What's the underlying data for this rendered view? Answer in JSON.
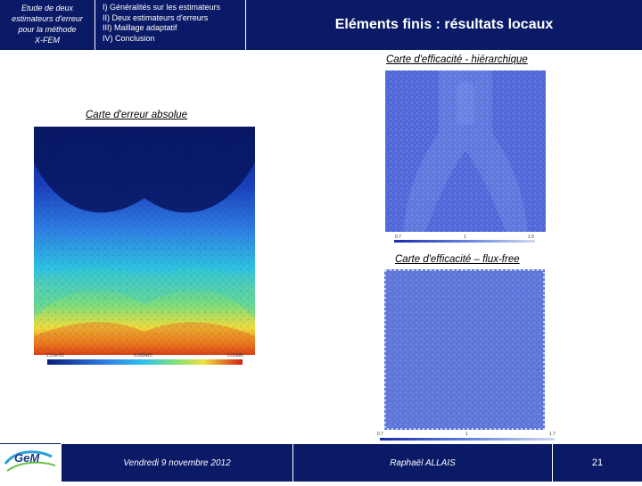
{
  "header": {
    "thesis_title_lines": [
      "Etude de deux",
      "estimateurs d'erreur",
      "pour la méthode",
      "X-FEM"
    ],
    "outline_items": [
      "I) Généralités sur les estimateurs",
      "II) Deux estimateurs d'erreurs",
      "III) Maillage adaptatif",
      "IV) Conclusion"
    ],
    "slide_title": "Eléments finis : résultats locaux"
  },
  "figures": {
    "absolute_error": {
      "caption": "Carte d'erreur  absolue",
      "legend_ticks": [
        "2.21e-05",
        "0.003425",
        "0.00685"
      ]
    },
    "hierarchical": {
      "caption": "Carte d'efficacité - hiérarchique",
      "legend_ticks": [
        "0.7",
        "1",
        "1.5"
      ]
    },
    "flux_free": {
      "caption": "Carte d'efficacité – flux-free",
      "legend_ticks": [
        "0.7",
        "1",
        "1.7"
      ]
    }
  },
  "footer": {
    "logo_text": "GeM",
    "date": "Vendredi 9 novembre 2012",
    "author": "Raphaël ALLAIS",
    "page_number": "21"
  },
  "colors": {
    "header_bg": "#0a1a66",
    "footer_bg": "#0a1a66"
  }
}
